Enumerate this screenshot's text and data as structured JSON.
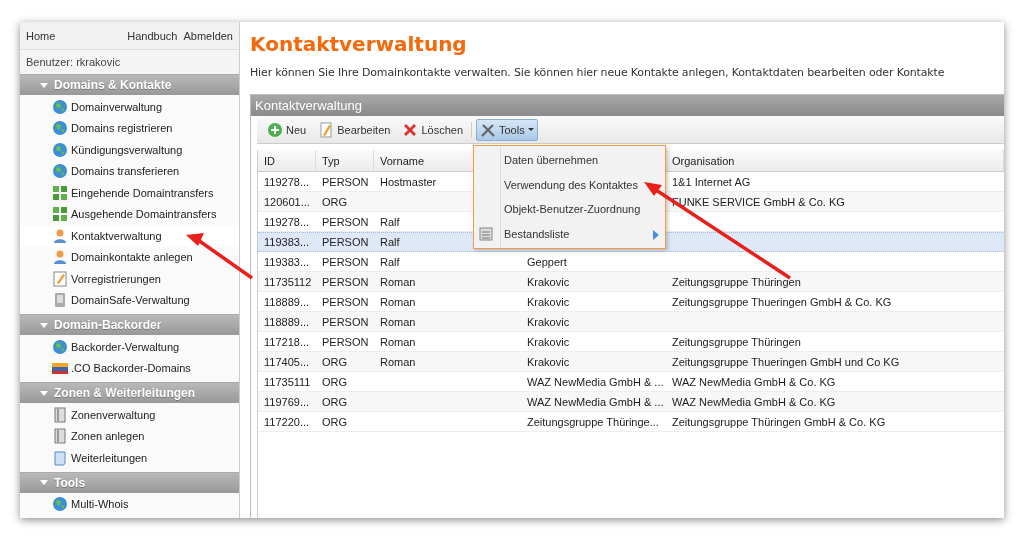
{
  "topnav": {
    "home": "Home",
    "links": [
      "Handbuch",
      "Abmelden"
    ]
  },
  "user": "Benutzer: rkrakovic",
  "sidebar": {
    "groups": [
      {
        "title": "Domains & Kontakte",
        "expanded": true,
        "items": [
          {
            "label": "Domainverwaltung",
            "kind": "globe",
            "selected": false
          },
          {
            "label": "Domains registrieren",
            "kind": "globe",
            "selected": false
          },
          {
            "label": "Kündigungsverwaltung",
            "kind": "globe",
            "selected": false
          },
          {
            "label": "Domains transferieren",
            "kind": "globe",
            "selected": false
          },
          {
            "label": "Eingehende Domaintransfers",
            "kind": "transfer",
            "selected": false
          },
          {
            "label": "Ausgehende Domaintransfers",
            "kind": "transfer",
            "selected": false
          },
          {
            "label": "Kontaktverwaltung",
            "kind": "person",
            "selected": true
          },
          {
            "label": "Domainkontakte anlegen",
            "kind": "person",
            "selected": false
          },
          {
            "label": "Vorregistrierungen",
            "kind": "note",
            "selected": false
          },
          {
            "label": "DomainSafe-Verwaltung",
            "kind": "safe",
            "selected": false
          }
        ]
      },
      {
        "title": "Domain-Backorder",
        "expanded": true,
        "items": [
          {
            "label": "Backorder-Verwaltung",
            "kind": "globe",
            "selected": false
          },
          {
            "label": ".CO Backorder-Domains",
            "kind": "flag",
            "selected": false
          }
        ]
      },
      {
        "title": "Zonen & Weiterleitungen",
        "expanded": true,
        "items": [
          {
            "label": "Zonenverwaltung",
            "kind": "server",
            "selected": false
          },
          {
            "label": "Zonen anlegen",
            "kind": "server",
            "selected": false
          },
          {
            "label": "Weiterleitungen",
            "kind": "page",
            "selected": false
          }
        ]
      },
      {
        "title": "Tools",
        "expanded": true,
        "items": [
          {
            "label": "Multi-Whois",
            "kind": "globe",
            "selected": false
          }
        ]
      }
    ]
  },
  "page": {
    "title": "Kontaktverwaltung",
    "description": "Hier können Sie Ihre Domainkontakte verwalten. Sie können hier neue Kontakte anlegen, Kontaktdaten bearbeiten oder Kontakte"
  },
  "panel": {
    "title": "Kontaktverwaltung",
    "toolbar": [
      {
        "label": "Neu",
        "kind": "add",
        "pressed": false
      },
      {
        "label": "Bearbeiten",
        "kind": "edit",
        "pressed": false
      },
      {
        "label": "Löschen",
        "kind": "delete",
        "pressed": false
      },
      {
        "label": "Tools",
        "kind": "tools",
        "pressed": true
      }
    ],
    "table": {
      "columns": [
        "ID",
        "Typ",
        "Vorname",
        "",
        "Organisation"
      ],
      "rows": [
        {
          "cells": [
            "119278...",
            "PERSON",
            "Hostmaster",
            "",
            "1&1 Internet AG"
          ],
          "selected": false
        },
        {
          "cells": [
            "120601...",
            "ORG",
            "",
            "",
            "FUNKE SERVICE GmbH & Co. KG"
          ],
          "selected": false
        },
        {
          "cells": [
            "119278...",
            "PERSON",
            "Ralf",
            "",
            ""
          ],
          "selected": false
        },
        {
          "cells": [
            "119383...",
            "PERSON",
            "Ralf",
            "",
            ""
          ],
          "selected": true
        },
        {
          "cells": [
            "119383...",
            "PERSON",
            "Ralf",
            "Geppert",
            ""
          ],
          "selected": false
        },
        {
          "cells": [
            "11735112",
            "PERSON",
            "Roman",
            "Krakovic",
            "Zeitungsgruppe Thüringen"
          ],
          "selected": false
        },
        {
          "cells": [
            "118889...",
            "PERSON",
            "Roman",
            "Krakovic",
            "Zeitungsgruppe Thueringen GmbH & Co. KG"
          ],
          "selected": false
        },
        {
          "cells": [
            "118889...",
            "PERSON",
            "Roman",
            "Krakovic",
            ""
          ],
          "selected": false
        },
        {
          "cells": [
            "117218...",
            "PERSON",
            "Roman",
            "Krakovic",
            "Zeitungsgruppe Thüringen"
          ],
          "selected": false
        },
        {
          "cells": [
            "117405...",
            "ORG",
            "Roman",
            "Krakovic",
            "Zeitungsgruppe Thueringen GmbH und Co KG"
          ],
          "selected": false
        },
        {
          "cells": [
            "11735111",
            "ORG",
            "",
            "WAZ NewMedia GmbH & ...",
            "WAZ NewMedia GmbH & Co. KG"
          ],
          "selected": false
        },
        {
          "cells": [
            "119769...",
            "ORG",
            "",
            "WAZ NewMedia GmbH & ...",
            "WAZ NewMedia GmbH & Co. KG"
          ],
          "selected": false
        },
        {
          "cells": [
            "117220...",
            "ORG",
            "",
            "Zeitungsgruppe Thüringe...",
            "Zeitungsgruppe Thüringen GmbH & Co. KG"
          ],
          "selected": false
        }
      ]
    }
  },
  "menu": {
    "items": [
      {
        "label": "Daten übernehmen",
        "has_icon": false,
        "submenu": false
      },
      {
        "label": "Verwendung des Kontaktes",
        "has_icon": false,
        "submenu": false
      },
      {
        "label": "Objekt-Benutzer-Zuordnung",
        "has_icon": false,
        "submenu": false
      },
      {
        "label": "Bestandsliste",
        "has_icon": true,
        "submenu": true
      }
    ]
  }
}
